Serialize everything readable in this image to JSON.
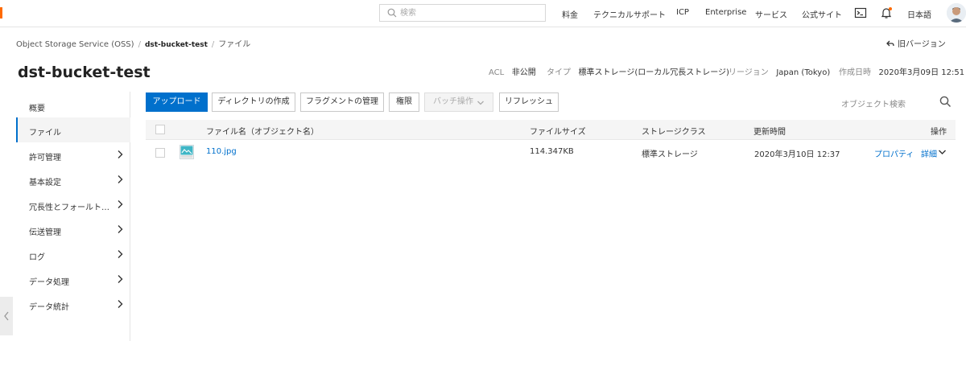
{
  "topbar": {
    "search_placeholder": "検索",
    "nav": [
      "料金",
      "テクニカルサポート",
      "ICP",
      "Enterprise",
      "サービス",
      "公式サイト"
    ],
    "language": "日本語",
    "icons": [
      "terminal-icon",
      "bell-icon"
    ],
    "accent_color": "#ff6a00"
  },
  "breadcrumb": {
    "items": [
      "Object Storage Service (OSS)",
      "dst-bucket-test",
      "ファイル"
    ],
    "separator": "/"
  },
  "old_version_label": "旧バージョン",
  "bucket": {
    "name": "dst-bucket-test",
    "meta": [
      {
        "key": "ACL",
        "value": "非公開"
      },
      {
        "key": "タイプ",
        "value": "標準ストレージ(ローカル冗長ストレージ)"
      },
      {
        "key": "リージョン",
        "value": "Japan (Tokyo)"
      },
      {
        "key": "作成日時",
        "value": "2020年3月09日 12:51"
      }
    ]
  },
  "sidebar": {
    "items": [
      {
        "label": "概要",
        "has_chevron": false,
        "active": false
      },
      {
        "label": "ファイル",
        "has_chevron": false,
        "active": true
      },
      {
        "label": "許可管理",
        "has_chevron": true,
        "active": false
      },
      {
        "label": "基本設定",
        "has_chevron": true,
        "active": false
      },
      {
        "label": "冗長性とフォールトト…",
        "has_chevron": true,
        "active": false
      },
      {
        "label": "伝送管理",
        "has_chevron": true,
        "active": false
      },
      {
        "label": "ログ",
        "has_chevron": true,
        "active": false
      },
      {
        "label": "データ処理",
        "has_chevron": true,
        "active": false
      },
      {
        "label": "データ統計",
        "has_chevron": true,
        "active": false
      }
    ]
  },
  "toolbar": {
    "upload": "アップロード",
    "create_dir": "ディレクトリの作成",
    "fragments": "フラグメントの管理",
    "permissions": "権限",
    "batch": "バッチ操作",
    "refresh": "リフレッシュ",
    "search_placeholder": "オブジェクト検索",
    "primary_color": "#0070cc"
  },
  "table": {
    "headers": [
      "ファイル名（オブジェクト名）",
      "ファイルサイズ",
      "ストレージクラス",
      "更新時間",
      "操作"
    ],
    "rows": [
      {
        "name": "110.jpg",
        "size": "114.347KB",
        "storage_class": "標準ストレージ",
        "updated": "2020年3月10日 12:37",
        "action_properties": "プロパティ",
        "action_details": "詳細"
      }
    ]
  }
}
